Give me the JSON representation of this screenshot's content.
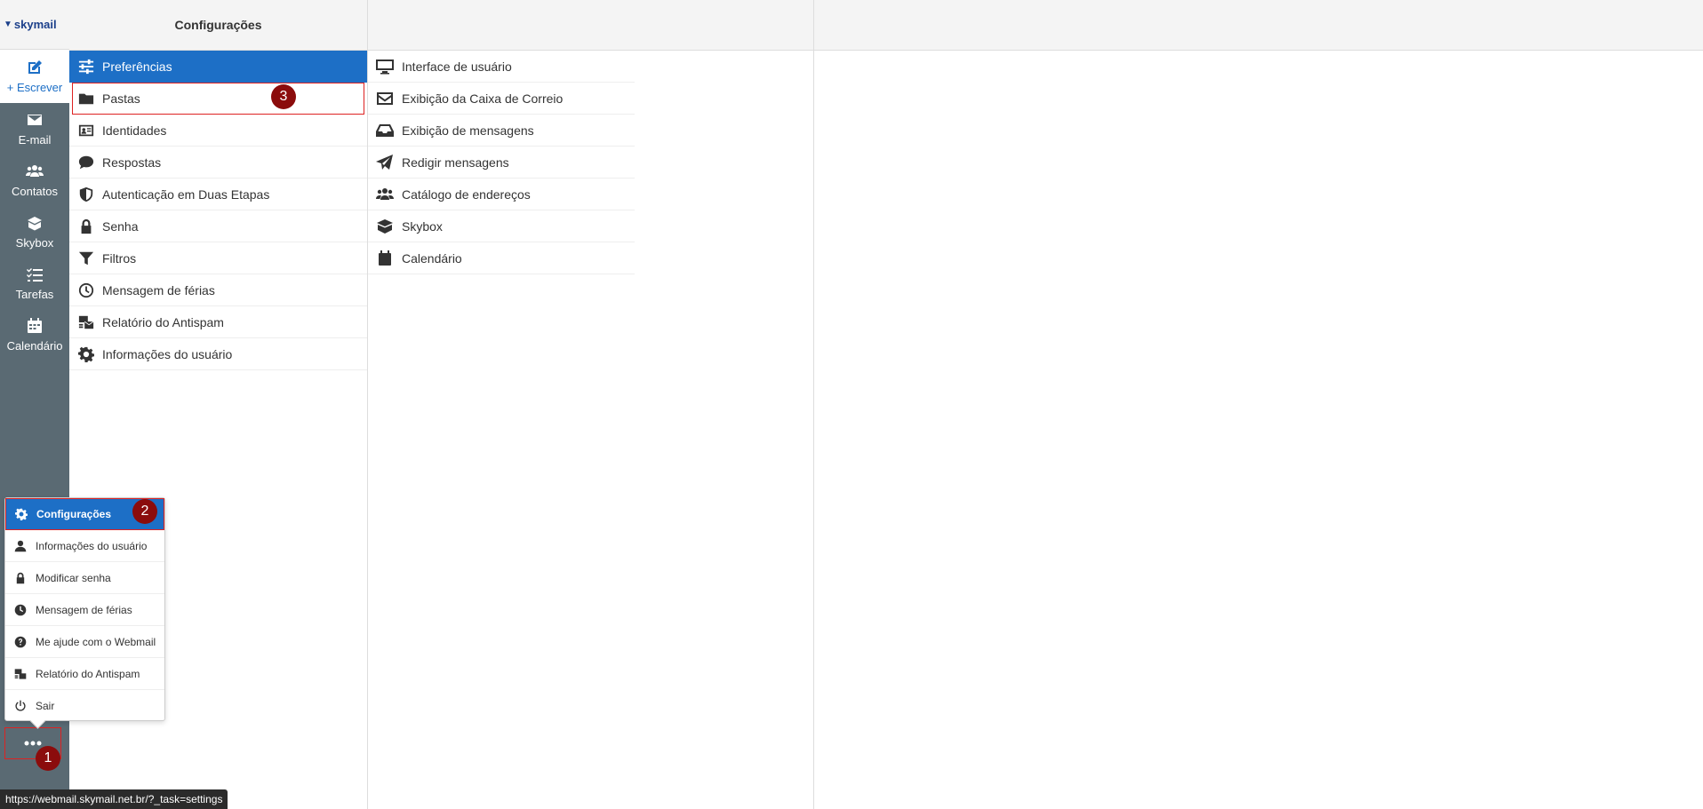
{
  "header": {
    "title": "Configurações"
  },
  "nav": {
    "compose": "+ Escrever",
    "items": [
      {
        "label": "E-mail",
        "icon": "envelope-icon"
      },
      {
        "label": "Contatos",
        "icon": "users-icon"
      },
      {
        "label": "Skybox",
        "icon": "box-icon"
      },
      {
        "label": "Tarefas",
        "icon": "tasks-icon"
      },
      {
        "label": "Calendário",
        "icon": "calendar-icon"
      }
    ]
  },
  "settings": {
    "items": [
      {
        "label": "Preferências",
        "icon": "sliders-icon"
      },
      {
        "label": "Pastas",
        "icon": "folder-icon"
      },
      {
        "label": "Identidades",
        "icon": "id-card-icon"
      },
      {
        "label": "Respostas",
        "icon": "comment-icon"
      },
      {
        "label": "Autenticação em Duas Etapas",
        "icon": "shield-icon"
      },
      {
        "label": "Senha",
        "icon": "lock-icon"
      },
      {
        "label": "Filtros",
        "icon": "filter-icon"
      },
      {
        "label": "Mensagem de férias",
        "icon": "clock-icon"
      },
      {
        "label": "Relatório do Antispam",
        "icon": "mail-bulk-icon"
      },
      {
        "label": "Informações do usuário",
        "icon": "gear-icon"
      }
    ]
  },
  "sections": {
    "items": [
      {
        "label": "Interface de usuário",
        "icon": "monitor-icon"
      },
      {
        "label": "Exibição da Caixa de Correio",
        "icon": "envelope-outline-icon"
      },
      {
        "label": "Exibição de mensagens",
        "icon": "inbox-icon"
      },
      {
        "label": "Redigir mensagens",
        "icon": "paper-plane-icon"
      },
      {
        "label": "Catálogo de endereços",
        "icon": "users-icon"
      },
      {
        "label": "Skybox",
        "icon": "box-icon"
      },
      {
        "label": "Calendário",
        "icon": "calendar-icon"
      }
    ]
  },
  "popup": {
    "items": [
      {
        "label": "Configurações",
        "icon": "gear-icon"
      },
      {
        "label": "Informações do usuário",
        "icon": "user-icon"
      },
      {
        "label": "Modificar senha",
        "icon": "lock-icon"
      },
      {
        "label": "Mensagem de férias",
        "icon": "clock-icon"
      },
      {
        "label": "Me ajude com o Webmail",
        "icon": "question-circle-icon"
      },
      {
        "label": "Relatório do Antispam",
        "icon": "mail-bulk-icon"
      },
      {
        "label": "Sair",
        "icon": "power-icon"
      }
    ]
  },
  "badges": {
    "one": "1",
    "two": "2",
    "three": "3"
  },
  "logo": {
    "text": "skymail"
  },
  "statusbar": {
    "url": "https://webmail.skymail.net.br/?_task=settings"
  },
  "colors": {
    "accent": "#1d6fc6",
    "nav_bg": "#5a6a73",
    "badge": "#8b0c0c",
    "highlight_border": "#dd2222"
  }
}
